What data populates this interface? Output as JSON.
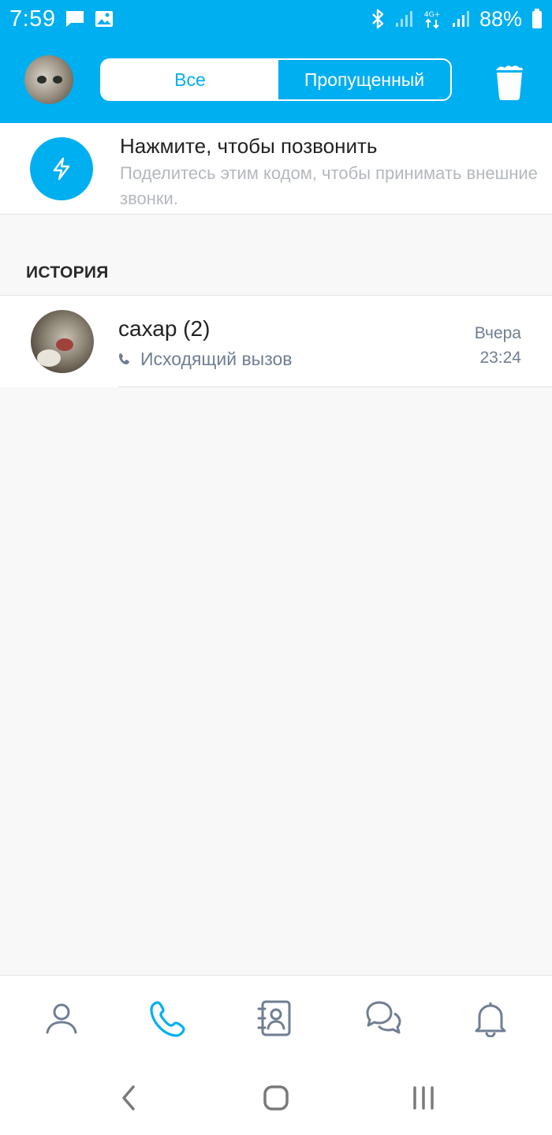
{
  "status_bar": {
    "time": "7:59",
    "battery": "88%",
    "network_label": "4G+",
    "icons": [
      "message-icon",
      "image-icon",
      "bluetooth-icon",
      "signal-icon",
      "data-icon",
      "signal-icon",
      "battery-icon"
    ]
  },
  "header": {
    "tabs": [
      {
        "label": "Все",
        "active": true
      },
      {
        "label": "Пропущенный",
        "active": false
      }
    ],
    "icons": [
      "avatar",
      "trash-icon"
    ]
  },
  "quick_call": {
    "title": "Нажмите, чтобы позвонить",
    "subtitle": "Поделитесь этим кодом, чтобы принимать внешние звонки.",
    "icon": "lightning-icon"
  },
  "history": {
    "section_label": "ИСТОРИЯ",
    "items": [
      {
        "name": "сахар (2)",
        "call_type": "Исходящий вызов",
        "day": "Вчера",
        "time": "23:24",
        "icon": "phone-icon"
      }
    ]
  },
  "bottom_nav": {
    "items": [
      "profile-icon",
      "calls-icon",
      "contacts-icon",
      "chats-icon",
      "notifications-icon"
    ],
    "active": "calls-icon"
  },
  "system_nav": {
    "items": [
      "back-icon",
      "home-icon",
      "recents-icon"
    ]
  },
  "colors": {
    "accent": "#00aff0",
    "secondary_text": "#6f7e92",
    "muted_text": "#b4b8be",
    "background": "#f8f8f8"
  }
}
